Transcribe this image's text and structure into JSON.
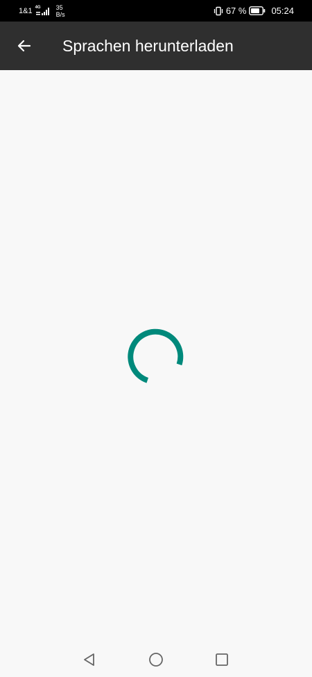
{
  "status_bar": {
    "carrier": "1&1",
    "network_type": "4G",
    "speed_value": "35",
    "speed_unit": "B/s",
    "battery_percent": "67 %",
    "time": "05:24",
    "icons": [
      "signal-icon",
      "vibrate-icon",
      "battery-icon"
    ]
  },
  "app_bar": {
    "back_icon": "arrow-left-icon",
    "title": "Sprachen herunterladen"
  },
  "content": {
    "loading": true,
    "spinner_color": "#00897b"
  },
  "nav_bar": {
    "icons": [
      "triangle-back-icon",
      "circle-home-icon",
      "square-recents-icon"
    ]
  },
  "colors": {
    "status_bar_bg": "#000000",
    "app_bar_bg": "#2f2f2f",
    "content_bg": "#f8f8f8",
    "accent": "#00897b"
  }
}
